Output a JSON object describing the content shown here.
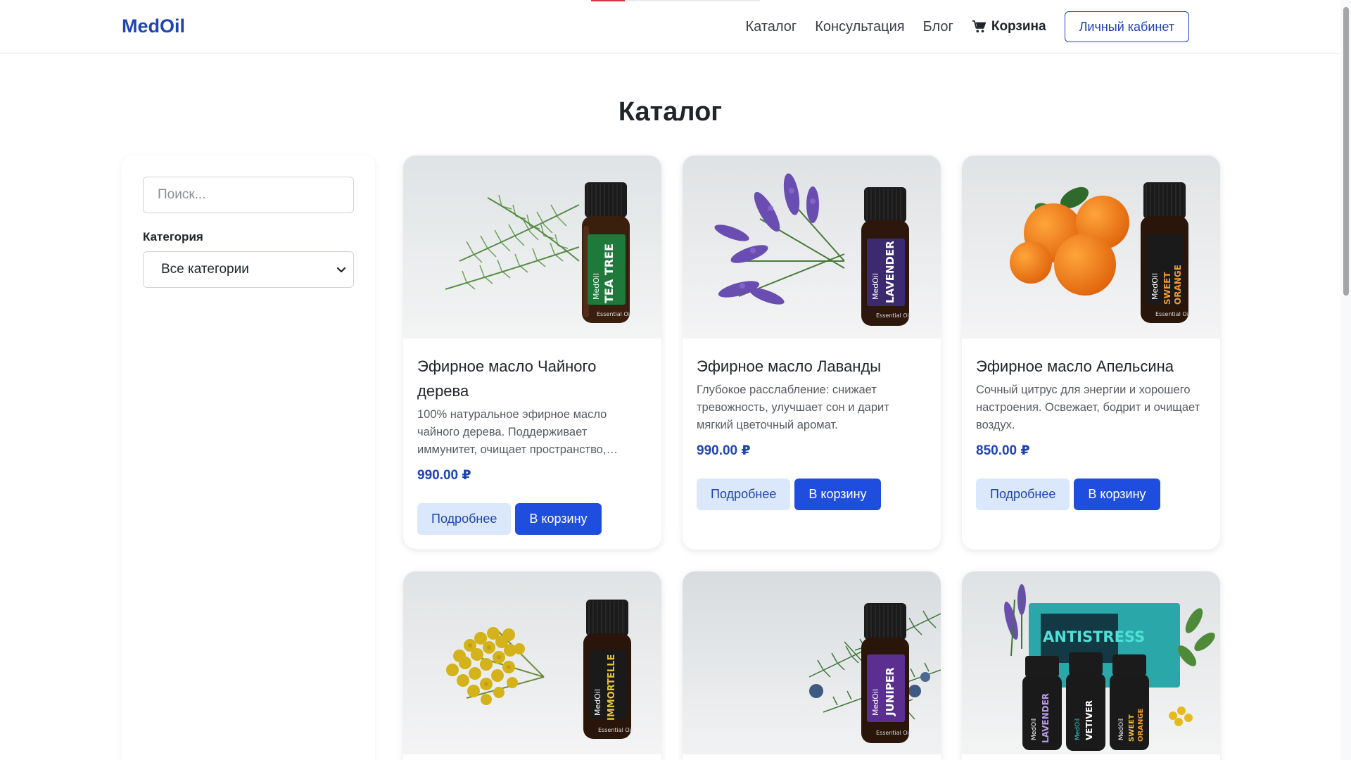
{
  "header": {
    "brand": "MedOil",
    "progress_fraction": 0.2,
    "nav": [
      {
        "label": "Каталог"
      },
      {
        "label": "Консультация"
      },
      {
        "label": "Блог"
      }
    ],
    "cart_label": "Корзина",
    "cart_icon": "shopping-cart-icon",
    "account_label": "Личный кабинет"
  },
  "page": {
    "title": "Каталог"
  },
  "sidebar": {
    "search_placeholder": "Поиск...",
    "category_label": "Категория",
    "category_selected": "Все категории",
    "dropdown_icon": "chevron-down-icon"
  },
  "colors": {
    "primary": "#1f44b4",
    "button_primary": "#1f4ede",
    "button_secondary_bg": "#dbe8fc",
    "accent_red": "#dc3545"
  },
  "products": [
    {
      "title": "Эфирное масло Чайного дерева",
      "description": "100% натуральное эфирное масло чайного дерева. Поддерживает иммунитет, очищает пространство, снимает воспаления.",
      "price": "990.00 ₽",
      "more_label": "Подробнее",
      "cart_label": "В корзину",
      "bottle": {
        "brand": "MedOil",
        "name": "TEA TREE",
        "label_color": "#1e7a3a",
        "sub": "Essential Oil"
      }
    },
    {
      "title": "Эфирное масло Лаванды",
      "description": "Глубокое расслабление: снижает тревожность, улучшает сон и дарит мягкий цветочный аромат.",
      "price": "990.00 ₽",
      "more_label": "Подробнее",
      "cart_label": "В корзину",
      "bottle": {
        "brand": "MedOil",
        "name": "LAVENDER",
        "label_color": "#3b2a6e",
        "sub": "Essential Oil"
      }
    },
    {
      "title": "Эфирное масло Апельсина",
      "description": "Сочный цитрус для энергии и хорошего настроения. Освежает, бодрит и очищает воздух.",
      "price": "850.00 ₽",
      "more_label": "Подробнее",
      "cart_label": "В корзину",
      "bottle": {
        "brand": "MedOil",
        "name": "SWEET ORANGE",
        "label_color": "#1a1a1a",
        "sub": "Essential Oil"
      }
    },
    {
      "bottle": {
        "brand": "MedOil",
        "name": "IMMORTELLE",
        "label_color": "#1a1a1a",
        "sub": "Essential Oil"
      }
    },
    {
      "bottle": {
        "brand": "MedOil",
        "name": "JUNIPER",
        "label_color": "#5b2f8f",
        "sub": "Essential Oil"
      }
    },
    {
      "box_label": "ANTISTRESS",
      "bottles": [
        {
          "brand": "MedOil",
          "name": "LAVENDER"
        },
        {
          "brand": "MedOil",
          "name": "VETIVER"
        },
        {
          "brand": "MedOil",
          "name": "SWEET ORANGE"
        }
      ]
    }
  ]
}
